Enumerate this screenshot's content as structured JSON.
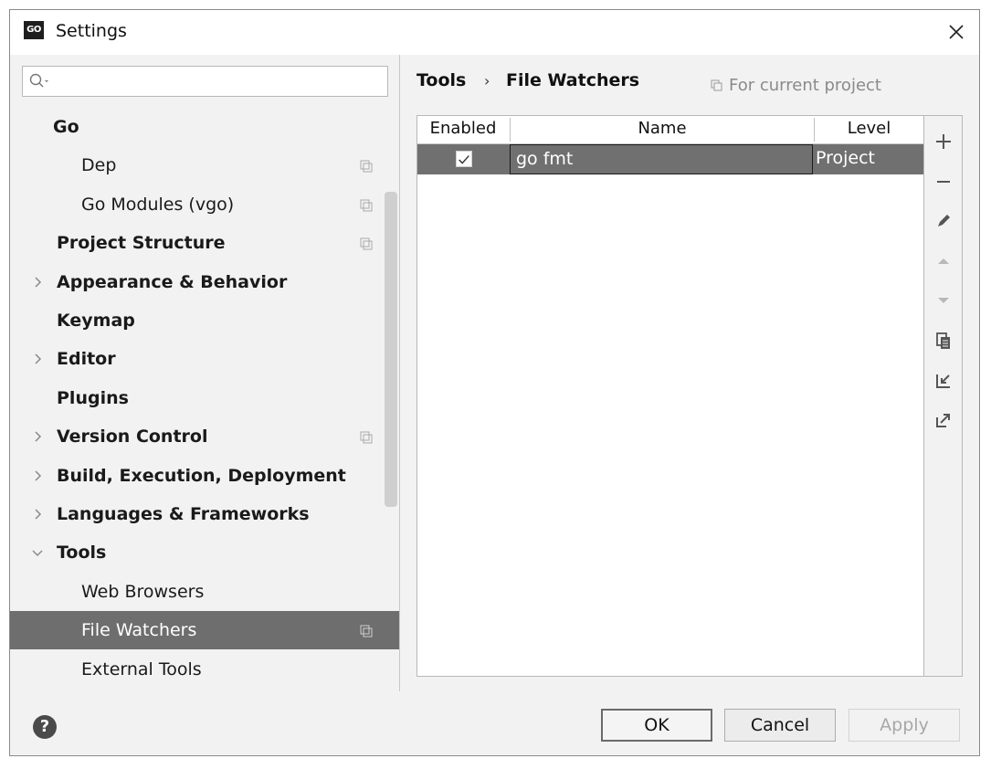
{
  "window": {
    "app_logo": "GO",
    "title": "Settings"
  },
  "sidebar": {
    "search_placeholder": "",
    "items": [
      {
        "label": "Go",
        "bold": true,
        "indent": 1,
        "arrow": "",
        "copy": false,
        "selected": false
      },
      {
        "label": "Dep",
        "bold": false,
        "indent": 2,
        "arrow": "",
        "copy": true,
        "selected": false
      },
      {
        "label": "Go Modules (vgo)",
        "bold": false,
        "indent": 2,
        "arrow": "",
        "copy": true,
        "selected": false
      },
      {
        "label": "Project Structure",
        "bold": true,
        "indent": 1,
        "arrow": "",
        "copy": true,
        "selected": false
      },
      {
        "label": "Appearance & Behavior",
        "bold": true,
        "indent": 1,
        "arrow": "collapsed",
        "copy": false,
        "selected": false
      },
      {
        "label": "Keymap",
        "bold": true,
        "indent": 1,
        "arrow": "",
        "copy": false,
        "selected": false
      },
      {
        "label": "Editor",
        "bold": true,
        "indent": 1,
        "arrow": "collapsed",
        "copy": false,
        "selected": false
      },
      {
        "label": "Plugins",
        "bold": true,
        "indent": 1,
        "arrow": "",
        "copy": false,
        "selected": false
      },
      {
        "label": "Version Control",
        "bold": true,
        "indent": 1,
        "arrow": "collapsed",
        "copy": true,
        "selected": false
      },
      {
        "label": "Build, Execution, Deployment",
        "bold": true,
        "indent": 1,
        "arrow": "collapsed",
        "copy": false,
        "selected": false
      },
      {
        "label": "Languages & Frameworks",
        "bold": true,
        "indent": 1,
        "arrow": "collapsed",
        "copy": false,
        "selected": false
      },
      {
        "label": "Tools",
        "bold": true,
        "indent": 1,
        "arrow": "expanded",
        "copy": false,
        "selected": false
      },
      {
        "label": "Web Browsers",
        "bold": false,
        "indent": 2,
        "arrow": "",
        "copy": false,
        "selected": false
      },
      {
        "label": "File Watchers",
        "bold": false,
        "indent": 2,
        "arrow": "",
        "copy": true,
        "selected": true
      },
      {
        "label": "External Tools",
        "bold": false,
        "indent": 2,
        "arrow": "",
        "copy": false,
        "selected": false
      }
    ]
  },
  "breadcrumb": {
    "parent": "Tools",
    "separator": "›",
    "current": "File Watchers",
    "scope_label": "For current project"
  },
  "table": {
    "columns": [
      "Enabled",
      "Name",
      "Level"
    ],
    "rows": [
      {
        "enabled": true,
        "name": "go fmt",
        "level": "Project",
        "selected": true
      }
    ]
  },
  "toolbar": {
    "buttons": [
      {
        "icon": "add-icon",
        "enabled": true
      },
      {
        "icon": "remove-icon",
        "enabled": true
      },
      {
        "icon": "edit-icon",
        "enabled": true
      },
      {
        "icon": "move-up-icon",
        "enabled": false
      },
      {
        "icon": "move-down-icon",
        "enabled": false
      },
      {
        "icon": "copy-icon",
        "enabled": true
      },
      {
        "icon": "import-icon",
        "enabled": true
      },
      {
        "icon": "export-icon",
        "enabled": true
      }
    ]
  },
  "footer": {
    "help": "?",
    "ok": "OK",
    "cancel": "Cancel",
    "apply": "Apply"
  }
}
